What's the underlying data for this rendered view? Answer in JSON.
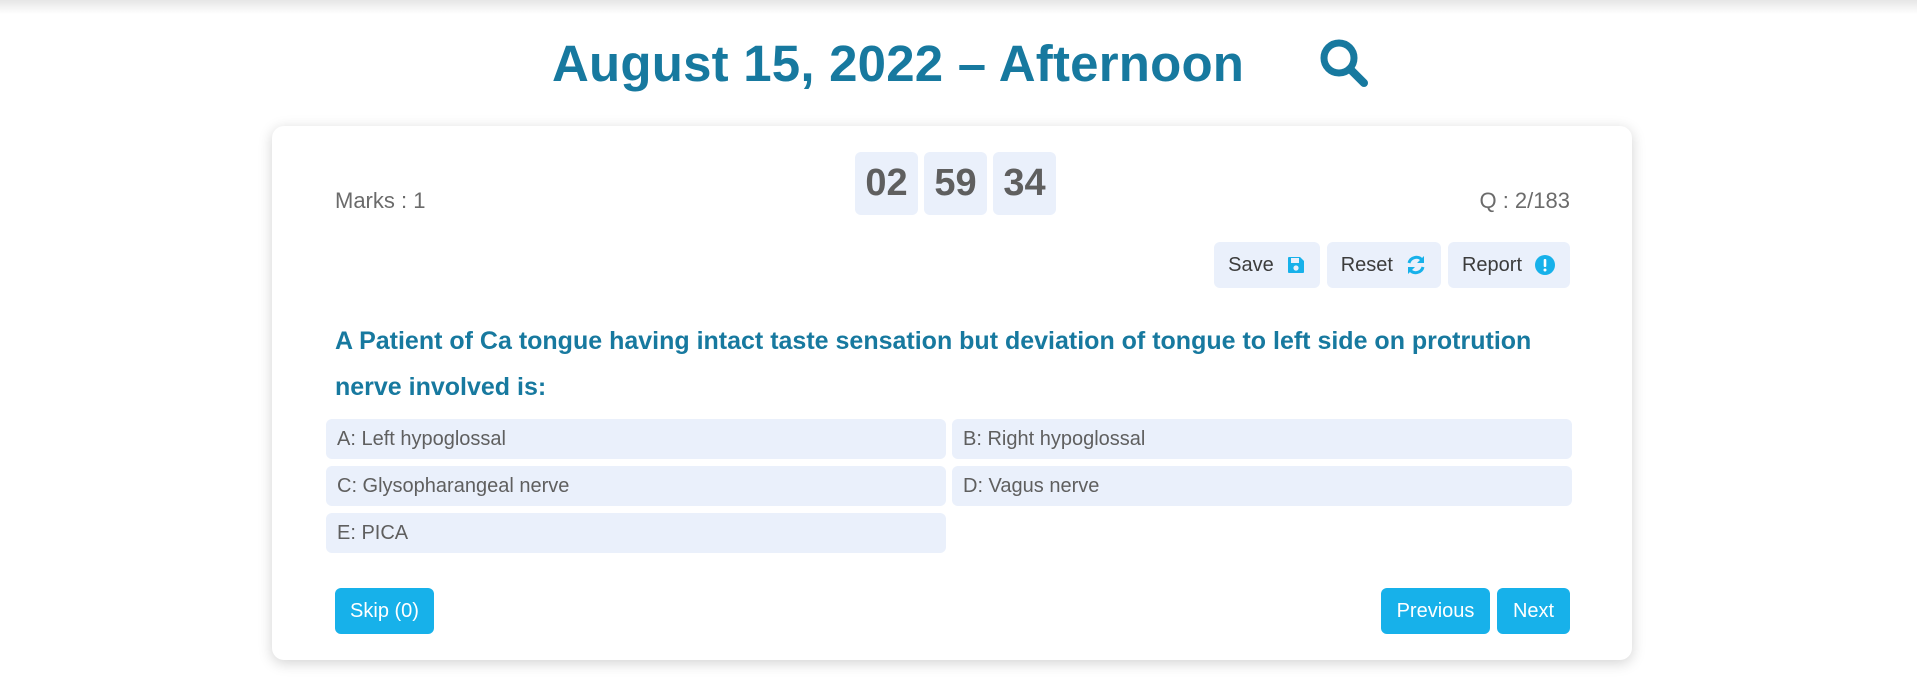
{
  "header": {
    "title": "August 15, 2022 – Afternoon",
    "search_icon": "search-icon"
  },
  "quiz": {
    "marks_label": "Marks : 1",
    "timer": {
      "hours": "02",
      "minutes": "59",
      "seconds": "34"
    },
    "question_count": "Q : 2/183",
    "actions": {
      "save_label": "Save",
      "save_icon": "floppy-disk-icon",
      "reset_label": "Reset",
      "reset_icon": "refresh-icon",
      "report_label": "Report",
      "report_icon": "exclamation-circle-icon"
    },
    "question": "A Patient of Ca tongue having intact taste sensation but deviation of tongue to left side on protrution nerve involved is:",
    "options": [
      {
        "label": "A: Left hypoglossal"
      },
      {
        "label": "B: Right hypoglossal"
      },
      {
        "label": "C: Glysopharangeal nerve"
      },
      {
        "label": "D: Vagus nerve"
      },
      {
        "label": "E: PICA"
      }
    ],
    "skip_label": "Skip (0)",
    "previous_label": "Previous",
    "next_label": "Next"
  },
  "colors": {
    "title": "#17799f",
    "accent": "#17b1ea",
    "option_bg": "#eaf0fb",
    "text_muted": "#6b6b6b"
  }
}
